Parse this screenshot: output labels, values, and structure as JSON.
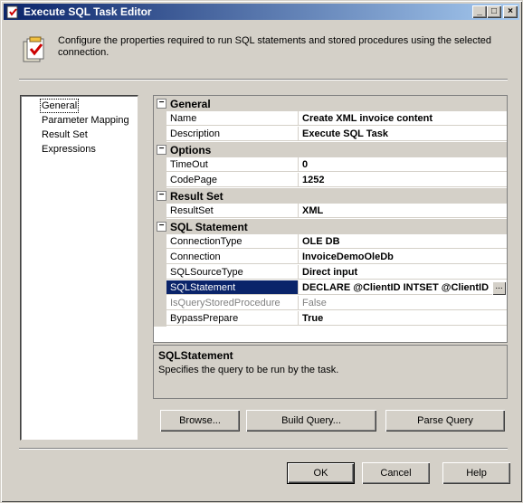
{
  "window": {
    "title": "Execute SQL Task Editor"
  },
  "header": {
    "description": "Configure the properties required to run SQL statements and stored procedures using the selected connection."
  },
  "nav": {
    "items": [
      {
        "label": "General",
        "selected": true
      },
      {
        "label": "Parameter Mapping"
      },
      {
        "label": "Result Set"
      },
      {
        "label": "Expressions"
      }
    ]
  },
  "grid": {
    "categories": [
      {
        "title": "General",
        "properties": [
          {
            "name": "Name",
            "value": "Create XML invoice content"
          },
          {
            "name": "Description",
            "value": "Execute SQL Task"
          }
        ]
      },
      {
        "title": "Options",
        "properties": [
          {
            "name": "TimeOut",
            "value": "0"
          },
          {
            "name": "CodePage",
            "value": "1252"
          }
        ]
      },
      {
        "title": "Result Set",
        "properties": [
          {
            "name": "ResultSet",
            "value": "XML"
          }
        ]
      },
      {
        "title": "SQL Statement",
        "properties": [
          {
            "name": "ConnectionType",
            "value": "OLE DB"
          },
          {
            "name": "Connection",
            "value": "InvoiceDemoOleDb"
          },
          {
            "name": "SQLSourceType",
            "value": "Direct input"
          },
          {
            "name": "SQLStatement",
            "value": "DECLARE @ClientID INTSET @ClientID",
            "selected": true
          },
          {
            "name": "IsQueryStoredProcedure",
            "value": "False",
            "disabled": true
          },
          {
            "name": "BypassPrepare",
            "value": "True"
          }
        ]
      }
    ],
    "ellipsis_label": "..."
  },
  "description_panel": {
    "title": "SQLStatement",
    "text": "Specifies the query to be run by the task."
  },
  "buttons": {
    "browse": "Browse...",
    "build_query": "Build Query...",
    "parse_query": "Parse Query",
    "ok": "OK",
    "cancel": "Cancel",
    "help": "Help"
  },
  "titlebar_buttons": {
    "minimize": "_",
    "maximize": "□",
    "close": "×"
  }
}
